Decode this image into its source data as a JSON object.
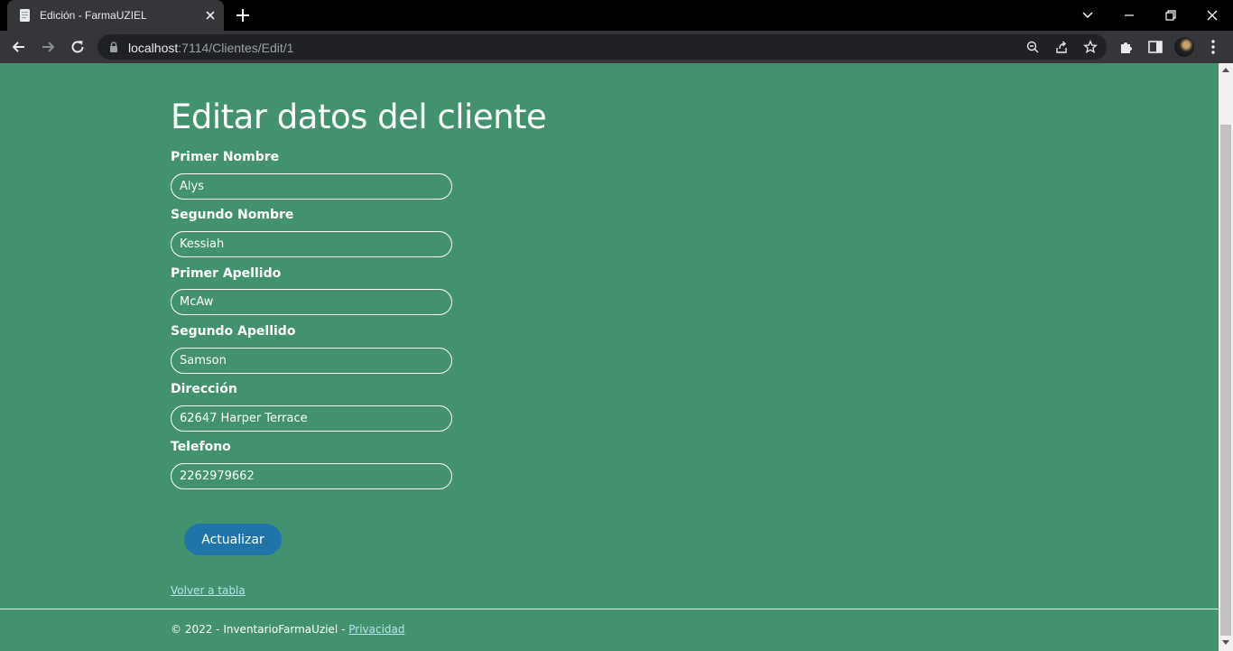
{
  "browser": {
    "tab_title": "Edición - FarmaUZIEL",
    "url_host": "localhost",
    "url_path": ":7114/Clientes/Edit/1"
  },
  "page": {
    "title": "Editar datos del cliente",
    "fields": [
      {
        "label": "Primer Nombre",
        "value": "Alys"
      },
      {
        "label": "Segundo Nombre",
        "value": "Kessiah"
      },
      {
        "label": "Primer Apellido",
        "value": "McAw"
      },
      {
        "label": "Segundo Apellido",
        "value": "Samson"
      },
      {
        "label": "Dirección",
        "value": "62647 Harper Terrace"
      },
      {
        "label": "Telefono",
        "value": "2262979662"
      }
    ],
    "submit_label": "Actualizar",
    "back_link": "Volver a tabla"
  },
  "footer": {
    "text": "© 2022 - InventarioFarmaUziel - ",
    "link": "Privacidad"
  },
  "colors": {
    "page_bg": "#42926e",
    "button_bg": "#1f75a8",
    "link": "#b7e3ef"
  },
  "icons": {
    "tab_favicon": "document-icon",
    "tab_close": "close-icon",
    "new_tab": "plus-icon",
    "back": "arrow-left-icon",
    "forward": "arrow-right-icon",
    "reload": "reload-icon",
    "lock": "lock-icon",
    "zoom": "zoom-out-icon",
    "share": "share-icon",
    "bookmark": "star-icon",
    "extensions": "puzzle-icon",
    "side_panel": "side-panel-icon",
    "menu": "kebab-menu-icon"
  }
}
